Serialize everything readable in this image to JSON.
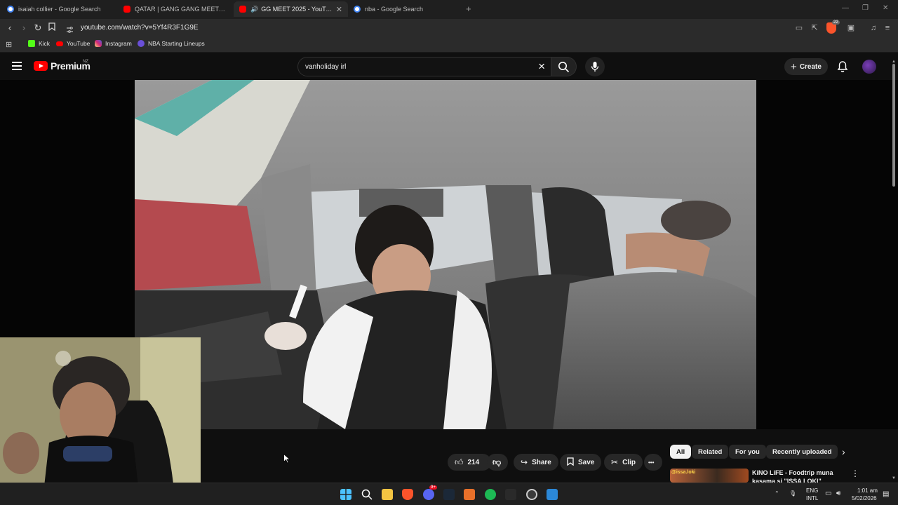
{
  "browser": {
    "tabs": [
      {
        "label": "isaiah collier - Google Search",
        "icon": "google-icon",
        "active": false
      },
      {
        "label": "QATAR | GANG GANG MEET 2026 - Y",
        "icon": "youtube-icon",
        "active": false
      },
      {
        "label": "GG MEET 2025 - YouTube",
        "icon": "youtube-icon",
        "active": true
      },
      {
        "label": "nba - Google Search",
        "icon": "google-icon",
        "active": false
      }
    ],
    "new_tab": "+",
    "url": "youtube.com/watch?v=5Yf4R3F1G9E",
    "bookmarks": [
      {
        "label": "Kick",
        "color": "#53fc18"
      },
      {
        "label": "YouTube",
        "color": "#ff0000"
      },
      {
        "label": "Instagram",
        "color": "#e1306c"
      },
      {
        "label": "NBA Starting Lineups",
        "color": "#6a4fd8"
      }
    ],
    "extension_badge": "22"
  },
  "youtube": {
    "logo_text": "Premium",
    "country_code": "NZ",
    "search_query": "vanholiday irl",
    "create_label": "Create",
    "actions": {
      "likes": "214",
      "share": "Share",
      "save": "Save",
      "clip": "Clip",
      "more": "•••"
    },
    "chips": [
      "All",
      "Related",
      "For you",
      "Recently uploaded"
    ],
    "recommendation": {
      "title": "KiNO LiFE - Foodtrip muna kasama si \"ISSA LOKI\"",
      "thumb_caption": "@issa.loki"
    }
  },
  "taskbar": {
    "lang_top": "ENG",
    "lang_bottom": "INTL",
    "time": "1:01 am",
    "date": "5/02/2026",
    "discord_badge": "9+"
  },
  "colors": {
    "youtube_red": "#ff0000",
    "page_bg": "#0f0f0f",
    "chip_active": "#f1f1f1"
  }
}
